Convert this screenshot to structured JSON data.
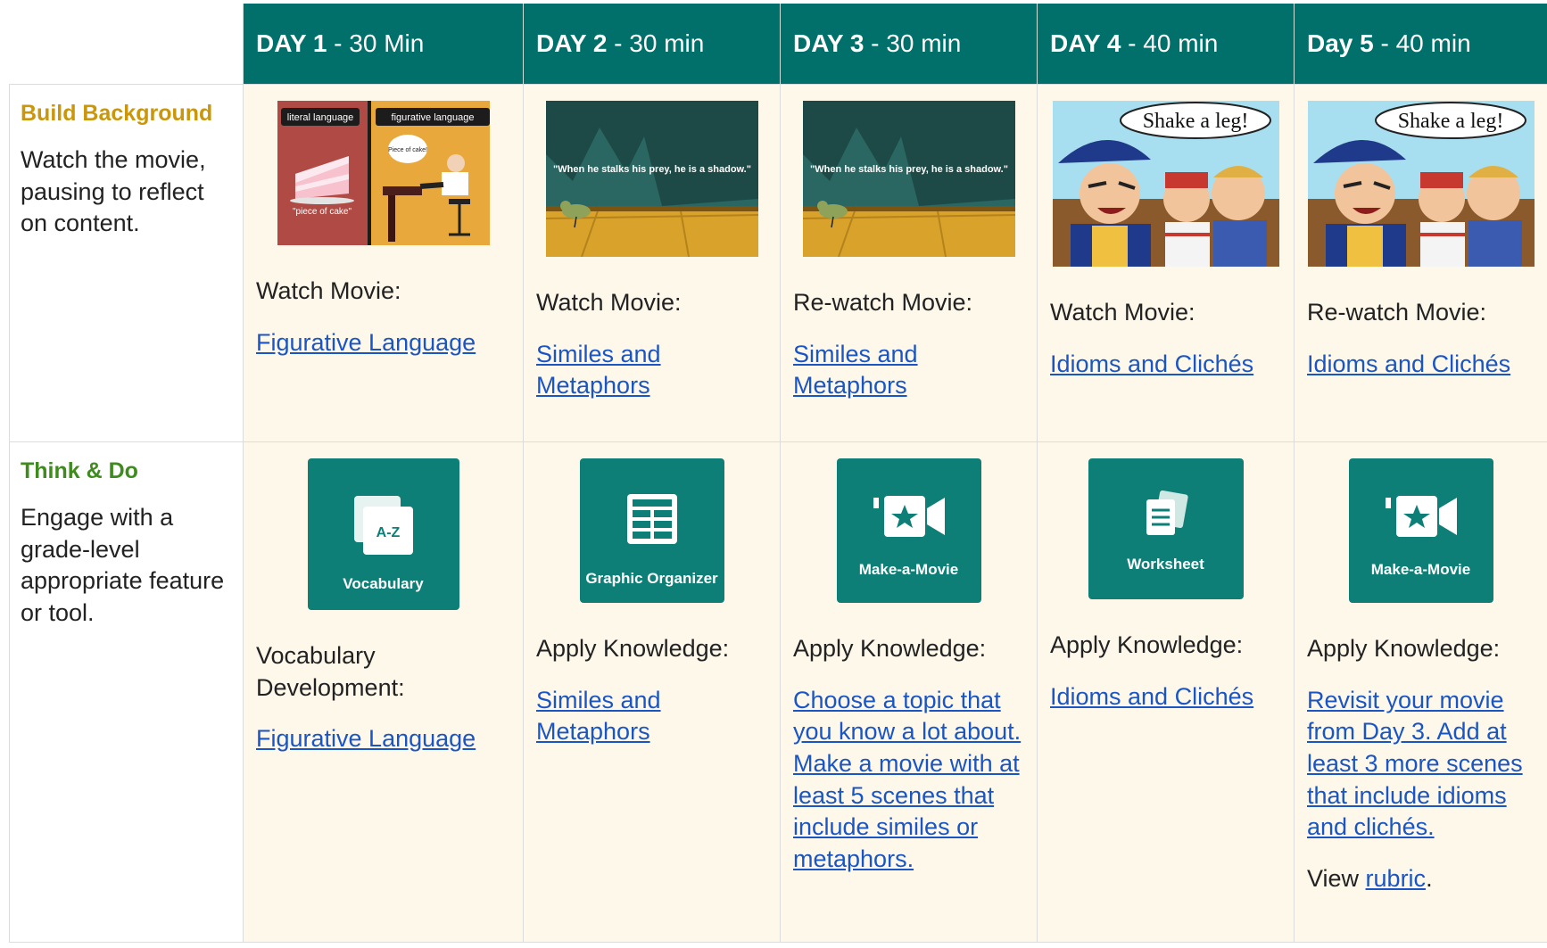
{
  "headers": [
    {
      "day": "DAY 1",
      "duration": " - 30 Min"
    },
    {
      "day": "DAY 2",
      "duration": " - 30 min"
    },
    {
      "day": "DAY 3",
      "duration": " - 30 min"
    },
    {
      "day": "DAY 4",
      "duration": " - 40 min"
    },
    {
      "day": "Day 5",
      "duration": " - 40 min"
    }
  ],
  "rows": {
    "build": {
      "title": "Build Background",
      "description": "Watch the movie, pausing to reflect on content.",
      "cells": [
        {
          "label": "Watch Movie:",
          "link": "Figurative Language",
          "image": {
            "left_tag": "literal language",
            "right_tag": "figurative language",
            "left_caption": "\"piece of cake\"",
            "bubble": "Piece of cake!"
          }
        },
        {
          "label": "Watch Movie:",
          "link": "Similes and Metaphors",
          "image": {
            "quote": "\"When he stalks his prey, he is a shadow.\""
          }
        },
        {
          "label": "Re-watch Movie:",
          "link": "Similes and Metaphors",
          "image": {
            "quote": "\"When he stalks his prey, he is a shadow.\""
          }
        },
        {
          "label": "Watch Movie:",
          "link": "Idioms and Clichés",
          "image": {
            "bubble": "Shake a leg!"
          }
        },
        {
          "label": "Re-watch Movie:",
          "link": "Idioms and Clichés",
          "image": {
            "bubble": "Shake a leg!"
          }
        }
      ]
    },
    "think": {
      "title": "Think & Do",
      "description": "Engage with a grade-level appropriate feature or tool.",
      "cells": [
        {
          "tile": "Vocabulary",
          "tile_icon": "vocabulary-card-icon",
          "tile_az": "A-Z",
          "label": "Vocabulary Development:",
          "link": "Figurative Language"
        },
        {
          "tile": "Graphic Organizer",
          "tile_icon": "graphic-organizer-icon",
          "label": "Apply Knowledge:",
          "link": "Similes and Metaphors"
        },
        {
          "tile": "Make-a-Movie",
          "tile_icon": "movie-camera-icon",
          "label": "Apply Knowledge:",
          "link": "Choose a topic that you know a lot about. Make a movie with at least 5 scenes that include similes or metaphors."
        },
        {
          "tile": "Worksheet",
          "tile_icon": "worksheet-icon",
          "label": "Apply Knowledge:",
          "link": "Idioms and Clichés"
        },
        {
          "tile": "Make-a-Movie",
          "tile_icon": "movie-camera-icon",
          "label": "Apply Knowledge:",
          "link": "Revisit your movie from Day 3. Add at least 3 more scenes that include idioms and clichés.",
          "view_prefix": "View ",
          "view_link": "rubric",
          "view_suffix": "."
        }
      ]
    }
  },
  "colors": {
    "header": "#02706a",
    "cell": "#fef8ea",
    "tile": "#0e7f77",
    "link": "#1a55c6",
    "gold": "#c9960c",
    "green": "#3f8b1e"
  }
}
